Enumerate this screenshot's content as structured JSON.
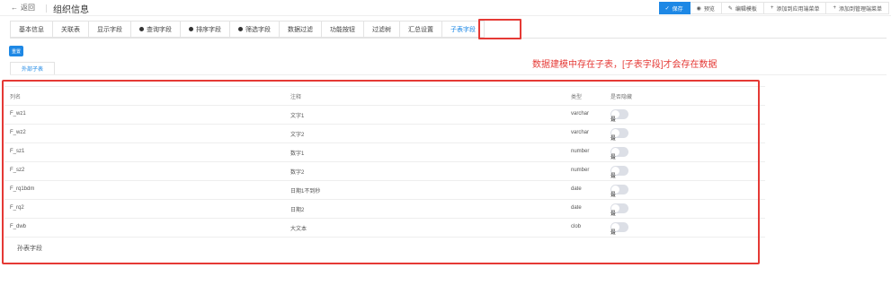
{
  "header": {
    "back_label": "返回",
    "page_title": "组织信息",
    "buttons": {
      "save": "保存",
      "preview": "预览",
      "edit_template": "编辑模板",
      "add_app_menu": "添加到应用端菜单",
      "add_admin_menu": "添加到管理端菜单"
    }
  },
  "tabs": [
    {
      "label": "基本信息"
    },
    {
      "label": "关联表"
    },
    {
      "label": "显示字段"
    },
    {
      "label": "查询字段",
      "icon": "dot"
    },
    {
      "label": "排序字段",
      "icon": "dot"
    },
    {
      "label": "筛选字段",
      "icon": "dot"
    },
    {
      "label": "数据过滤"
    },
    {
      "label": "功能按钮"
    },
    {
      "label": "过滤树"
    },
    {
      "label": "汇总设置"
    },
    {
      "label": "子表字段",
      "active": true
    }
  ],
  "refresh_label": "重置",
  "sub_tab_label": "外部子表",
  "annotation": "数据建模中存在子表，[子表字段]才会存在数据",
  "table": {
    "columns": [
      "列名",
      "注释",
      "类型",
      "是否隐藏"
    ],
    "toggle_no": "否",
    "toggle_yes": "是",
    "rows": [
      {
        "name": "F_wz1",
        "comment": "文字1",
        "type": "varchar"
      },
      {
        "name": "F_wz2",
        "comment": "文字2",
        "type": "varchar"
      },
      {
        "name": "F_sz1",
        "comment": "数字1",
        "type": "number"
      },
      {
        "name": "F_sz2",
        "comment": "数字2",
        "type": "number"
      },
      {
        "name": "F_rq1bdm",
        "comment": "日期1不到秒",
        "type": "date"
      },
      {
        "name": "F_rq2",
        "comment": "日期2",
        "type": "date"
      },
      {
        "name": "F_dwb",
        "comment": "大文本",
        "type": "clob"
      }
    ]
  },
  "footer_label": "孙表字段",
  "colors": {
    "accent": "#1e88e5",
    "highlight": "#e53935"
  }
}
